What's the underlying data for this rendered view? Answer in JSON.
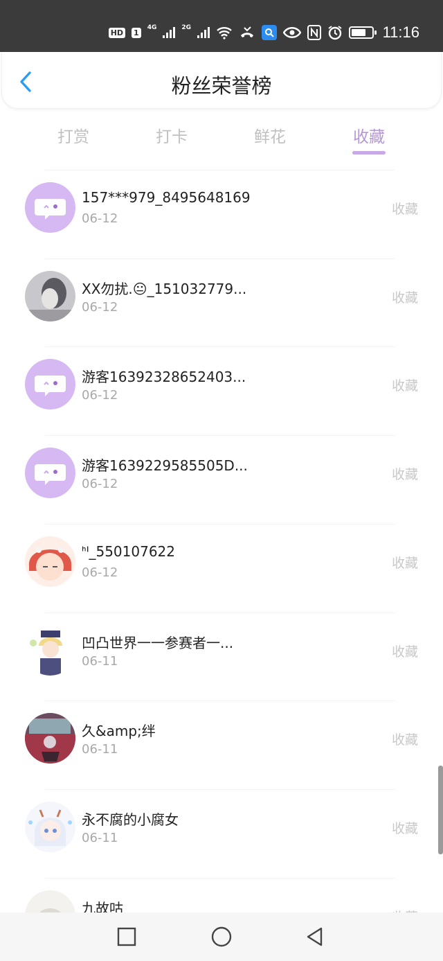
{
  "status_bar": {
    "time": "11:16",
    "hd": "HD",
    "sim": "1",
    "net1": "4G",
    "net2": "2G"
  },
  "header": {
    "title": "粉丝荣誉榜"
  },
  "tabs": [
    {
      "label": "打赏",
      "active": false
    },
    {
      "label": "打卡",
      "active": false
    },
    {
      "label": "鲜花",
      "active": false
    },
    {
      "label": "收藏",
      "active": true
    }
  ],
  "list": [
    {
      "name": "157***979_8495648169",
      "date": "06-12",
      "action": "收藏",
      "avatar": "default-chat-avatar"
    },
    {
      "name": "XX勿扰.😐_151032779...",
      "date": "06-12",
      "action": "收藏",
      "avatar": "user-photo"
    },
    {
      "name": "游客16392328652403...",
      "date": "06-12",
      "action": "收藏",
      "avatar": "default-chat-avatar"
    },
    {
      "name": "游客1639229585505D...",
      "date": "06-12",
      "action": "收藏",
      "avatar": "default-chat-avatar"
    },
    {
      "name": "ᑋᑊ_550107622",
      "date": "06-12",
      "action": "收藏",
      "avatar": "anime-girl-red-hood"
    },
    {
      "name": "凹凸世界一一参赛者一...",
      "date": "06-11",
      "action": "收藏",
      "avatar": "anime-boy"
    },
    {
      "name": "久&amp;绊",
      "date": "06-11",
      "action": "收藏",
      "avatar": "anime-scene"
    },
    {
      "name": "永不腐的小腐女",
      "date": "06-11",
      "action": "收藏",
      "avatar": "anime-white-hair"
    },
    {
      "name": "九故咕",
      "date": "",
      "action": "收藏",
      "avatar": "anime-pale"
    }
  ],
  "colors": {
    "accent": "#b497d6",
    "avatar_bg": "#d6b8f2"
  }
}
